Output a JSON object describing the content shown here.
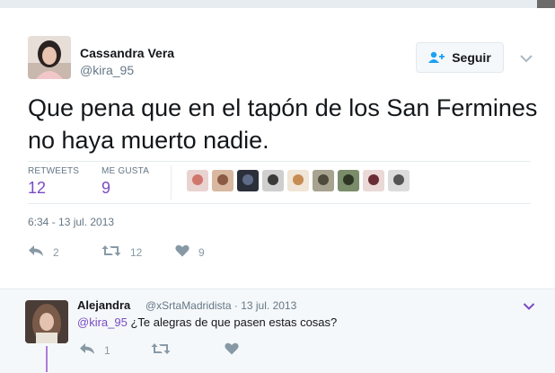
{
  "tweet": {
    "author_name": "Cassandra Vera",
    "author_handle": "@kira_95",
    "follow_label": "Seguir",
    "text": "Que pena que en el tapón de los San Fermines no haya muerto nadie.",
    "retweets_label": "RETWEETS",
    "retweets_count": "12",
    "likes_label": "ME GUSTA",
    "likes_count": "9",
    "timestamp": "6:34 - 13 jul. 2013",
    "actions": {
      "reply_count": "2",
      "retweet_count": "12",
      "like_count": "9"
    },
    "liker_avatar_count": 9
  },
  "reply": {
    "author_name": "Alejandra",
    "meta": "@xSrtaMadridista · 13 jul. 2013",
    "mention": "@kira_95",
    "text": " ¿Te alegras de que pasen estas cosas?",
    "actions": {
      "reply_count": "1"
    }
  },
  "colors": {
    "accent": "#794bc4",
    "muted": "#657786",
    "icon": "#8899a6",
    "reply_bg": "#f5f8fa",
    "thread_line": "#b07ad8"
  },
  "icons": {
    "follow": "follow-person-plus-icon",
    "dropdown": "chevron-down-icon",
    "reply": "reply-arrow-icon",
    "retweet": "retweet-icon",
    "like": "heart-icon"
  }
}
